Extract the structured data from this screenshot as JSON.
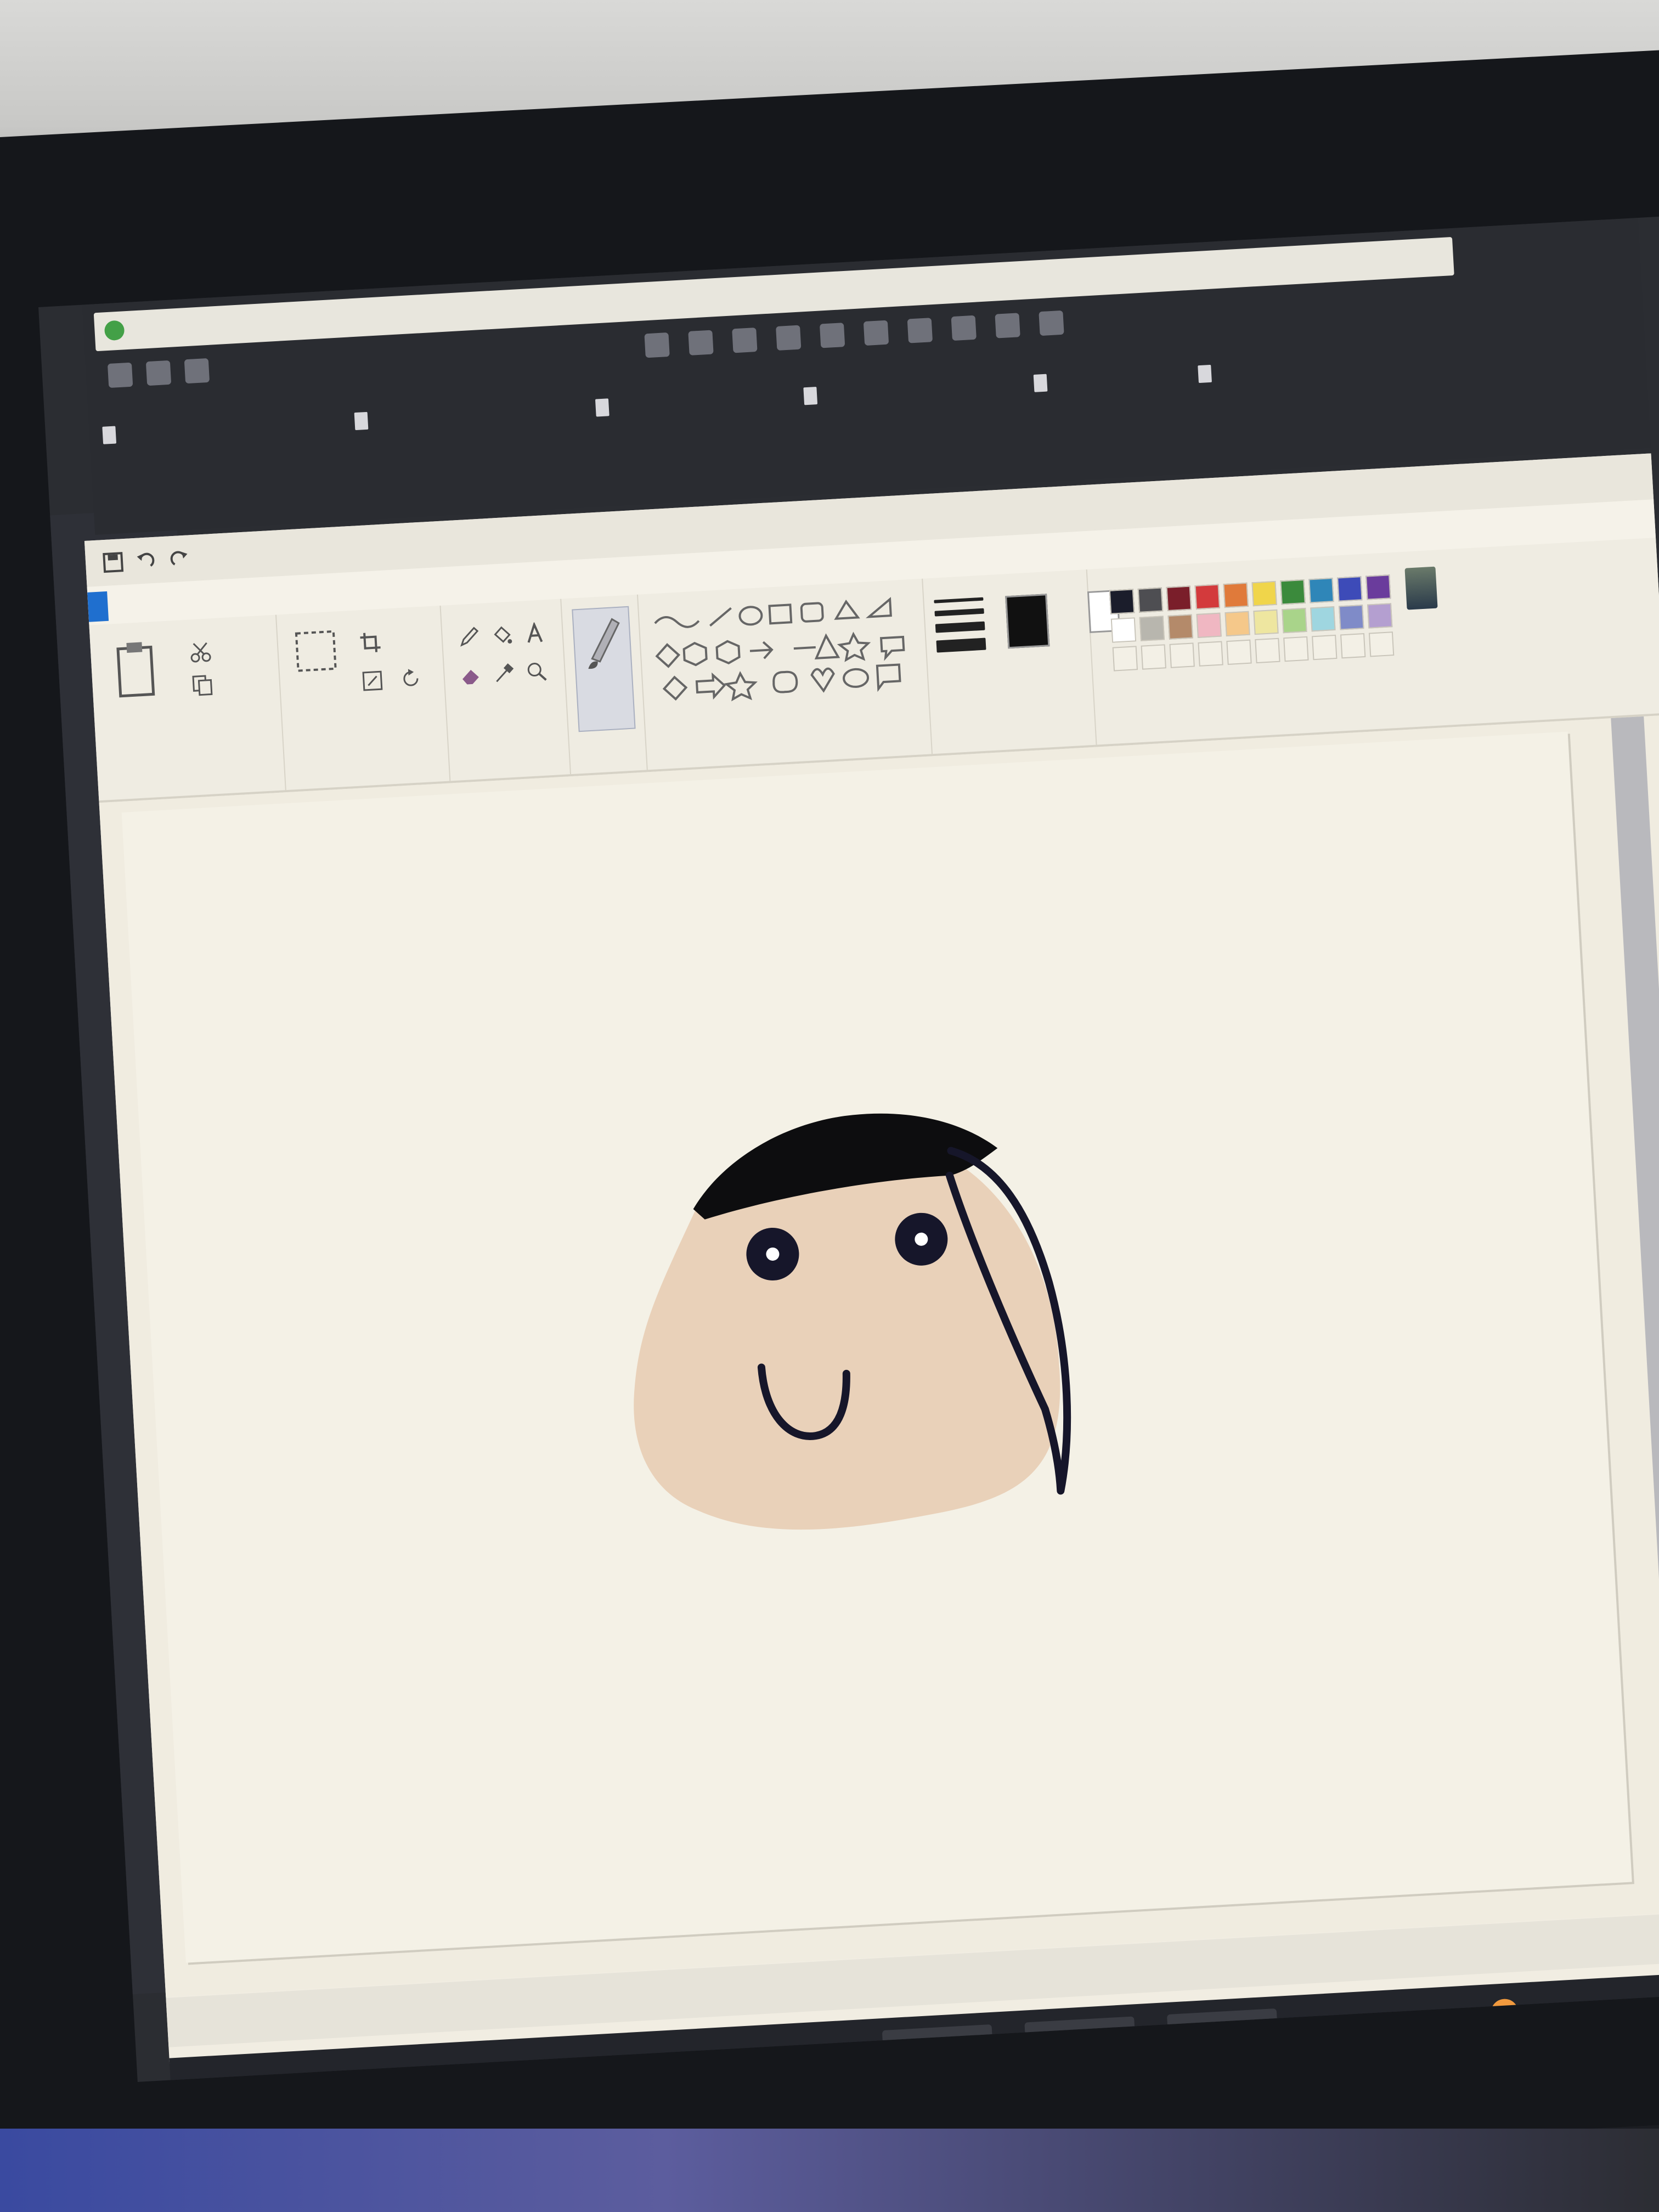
{
  "screen": {
    "side_panel_lines": [
      "",
      "",
      "",
      "",
      "",
      "",
      "",
      "",
      "",
      "",
      "",
      "",
      "",
      "",
      "",
      "",
      "",
      "",
      "",
      "",
      ""
    ]
  },
  "browser": {
    "bookmarks": [
      "",
      "",
      "",
      "",
      "",
      ""
    ]
  },
  "paint": {
    "title": "",
    "tabs": [
      {
        "label": "",
        "active": true
      },
      {
        "label": ""
      },
      {
        "label": ""
      }
    ],
    "groups": [
      "",
      "",
      "",
      "",
      "",
      "",
      ""
    ],
    "palette": [
      "#1b1d2b",
      "#4e4e52",
      "#7a1e2a",
      "#d33a3c",
      "#e07a3a",
      "#f0d54a",
      "#3b8a3c",
      "#2f86b8",
      "#3d4bb8",
      "#6a3c9c",
      "#ffffff",
      "#b8b6ae",
      "#b48a6a",
      "#f0b7c2",
      "#f5c88a",
      "#eee6a0",
      "#a9d48a",
      "#9fd6e0",
      "#7f8bc8",
      "#b49fd0"
    ],
    "primary_color": "#111111",
    "secondary_color": "#ffffff",
    "drawing": {
      "face_color": "#e9d1b9",
      "hair_color": "#0d0d0f",
      "line_color": "#16162a"
    },
    "status": {
      "position": "",
      "size": "",
      "zoom": ""
    }
  },
  "taskbar": {
    "weather": "",
    "tray": ""
  }
}
